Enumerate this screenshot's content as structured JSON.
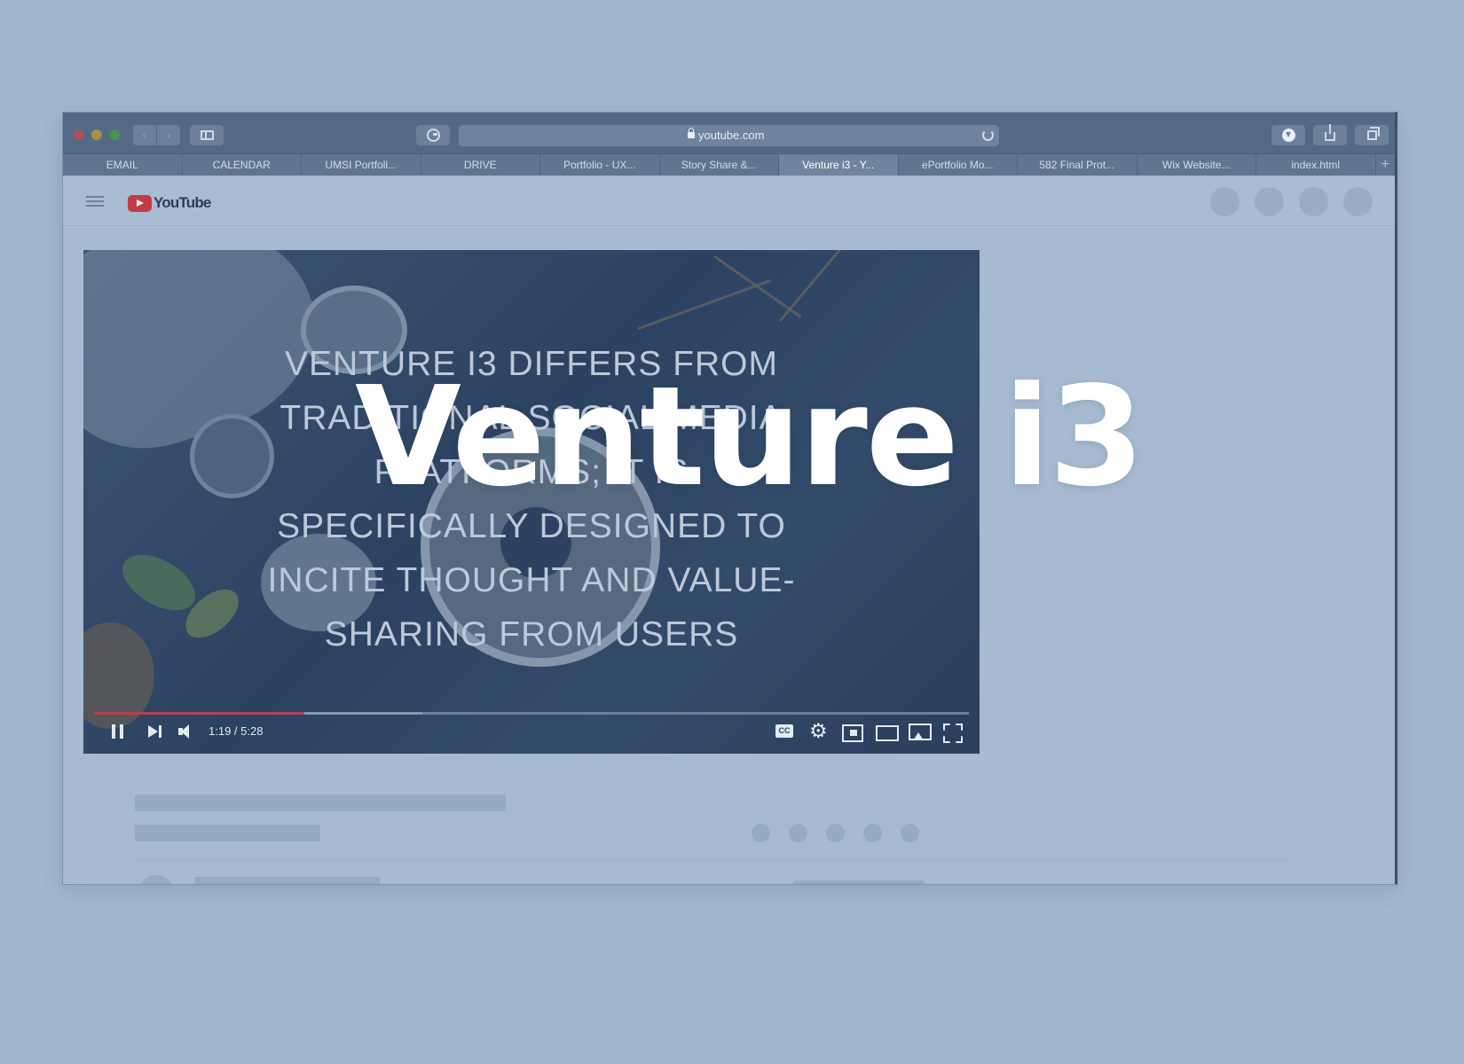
{
  "browser": {
    "url": "youtube.com",
    "tabs": [
      {
        "label": "EMAIL",
        "active": false
      },
      {
        "label": "CALENDAR",
        "active": false
      },
      {
        "label": "UMSI Portfoli...",
        "active": false
      },
      {
        "label": "DRIVE",
        "active": false
      },
      {
        "label": "Portfolio - UX...",
        "active": false
      },
      {
        "label": "Story Share &...",
        "active": false
      },
      {
        "label": "Venture i3 - Y...",
        "active": true
      },
      {
        "label": "ePortfolio Mo...",
        "active": false
      },
      {
        "label": "582 Final Prot...",
        "active": false
      },
      {
        "label": "Wix Website...",
        "active": false
      },
      {
        "label": "index.html",
        "active": false
      }
    ],
    "new_tab_label": "+",
    "nav_back_label": "‹",
    "nav_forward_label": "›"
  },
  "youtube": {
    "logo_text": "YouTube",
    "brand_color": "#c33b48"
  },
  "video": {
    "caption_lines": [
      "Venture i3 differs from",
      "traditional social media",
      "platforms; it is",
      "specifically designed to",
      "incite thought and value-",
      "sharing from users"
    ],
    "time_display": "1:19 / 5:28",
    "played_fraction": 0.24,
    "buffered_fraction": 0.375
  },
  "overlay_title": "Venture i3"
}
